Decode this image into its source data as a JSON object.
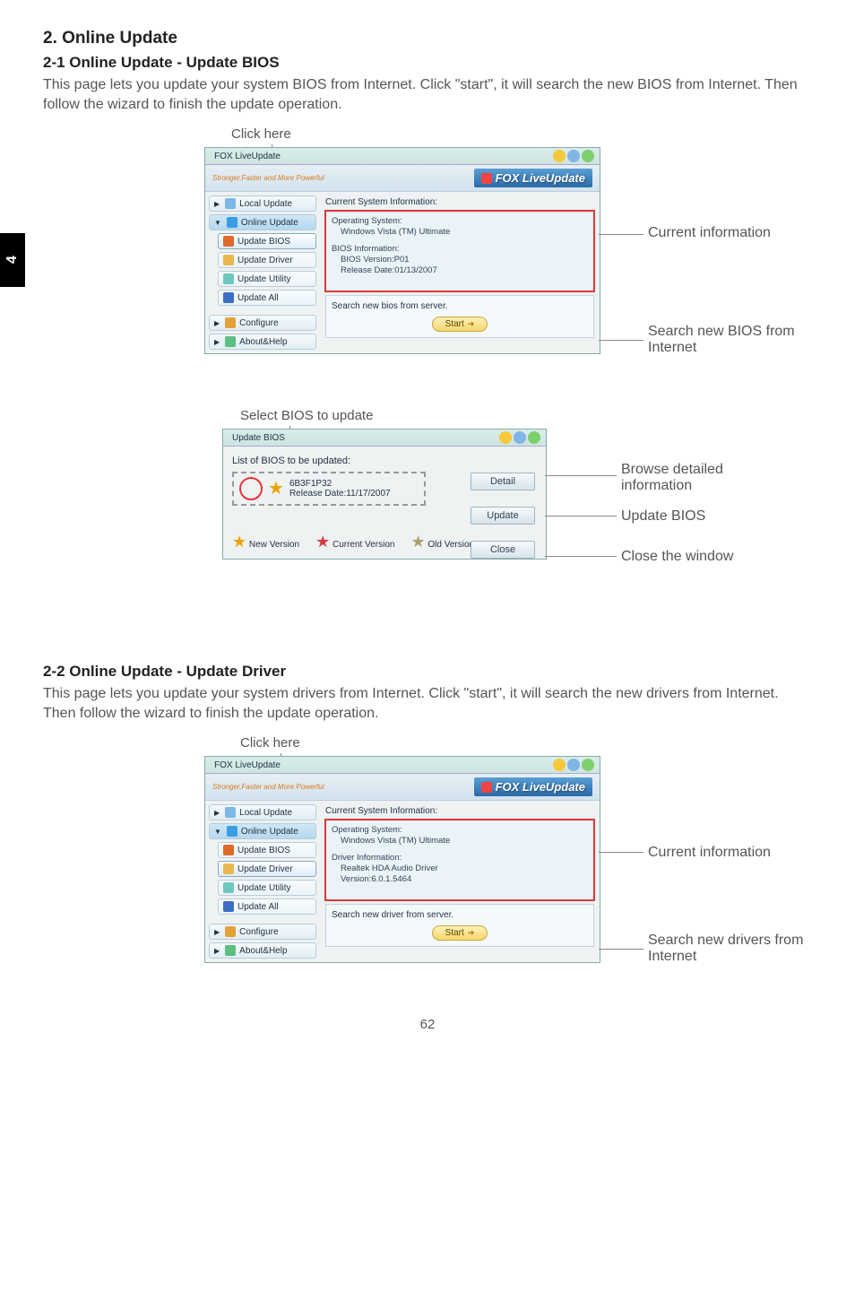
{
  "chapter_tab": "4",
  "section_title": "2. Online Update",
  "sub1_title": "2-1 Online Update - Update BIOS",
  "sub1_body": "This page lets you update your system BIOS from Internet. Click \"start\", it will search the new BIOS from Internet. Then follow the wizard to finish the update operation.",
  "sub2_title": "2-2 Online Update - Update Driver",
  "sub2_body": "This page lets you update your system drivers from Internet. Click \"start\", it will search the new drivers from Internet. Then follow the wizard to finish the update operation.",
  "callouts": {
    "click_here": "Click here",
    "current_info": "Current information",
    "search_bios": "Search new BIOS from Internet",
    "select_bios": "Select BIOS to update",
    "browse_detailed": "Browse detailed information",
    "update_bios": "Update BIOS",
    "close_window": "Close the window",
    "search_drivers": "Search new drivers from Internet"
  },
  "app": {
    "title": "FOX LiveUpdate",
    "tagline": "Stronger,Faster and More Powerful",
    "brand": "FOX LiveUpdate",
    "sidebar": {
      "local_update": "Local Update",
      "online_update": "Online Update",
      "update_bios": "Update BIOS",
      "update_driver": "Update Driver",
      "update_utility": "Update Utility",
      "update_all": "Update All",
      "configure": "Configure",
      "about_help": "About&Help"
    },
    "main_bios": {
      "header": "Current System Information:",
      "os_label": "Operating System:",
      "os_value": "Windows Vista (TM) Ultimate",
      "bios_label": "BIOS Information:",
      "bios_version": "BIOS Version:P01",
      "bios_date": "Release Date:01/13/2007",
      "search_label": "Search new bios from server.",
      "start": "Start"
    },
    "main_driver": {
      "header": "Current System Information:",
      "os_label": "Operating System:",
      "os_value": "Windows Vista (TM) Ultimate",
      "drv_label": "Driver Information:",
      "drv_name": "Realtek HDA Audio Driver",
      "drv_version": "Version:6.0.1.5464",
      "search_label": "Search new driver from server.",
      "start": "Start"
    }
  },
  "dlg": {
    "title": "Update BIOS",
    "list_label": "List of BIOS to be updated:",
    "item": {
      "name": "6B3F1P32",
      "date": "Release Date:11/17/2007"
    },
    "buttons": {
      "detail": "Detail",
      "update": "Update",
      "close": "Close"
    },
    "legend": {
      "new": "New Version",
      "current": "Current Version",
      "old": "Old Version"
    }
  },
  "page_number": "62"
}
